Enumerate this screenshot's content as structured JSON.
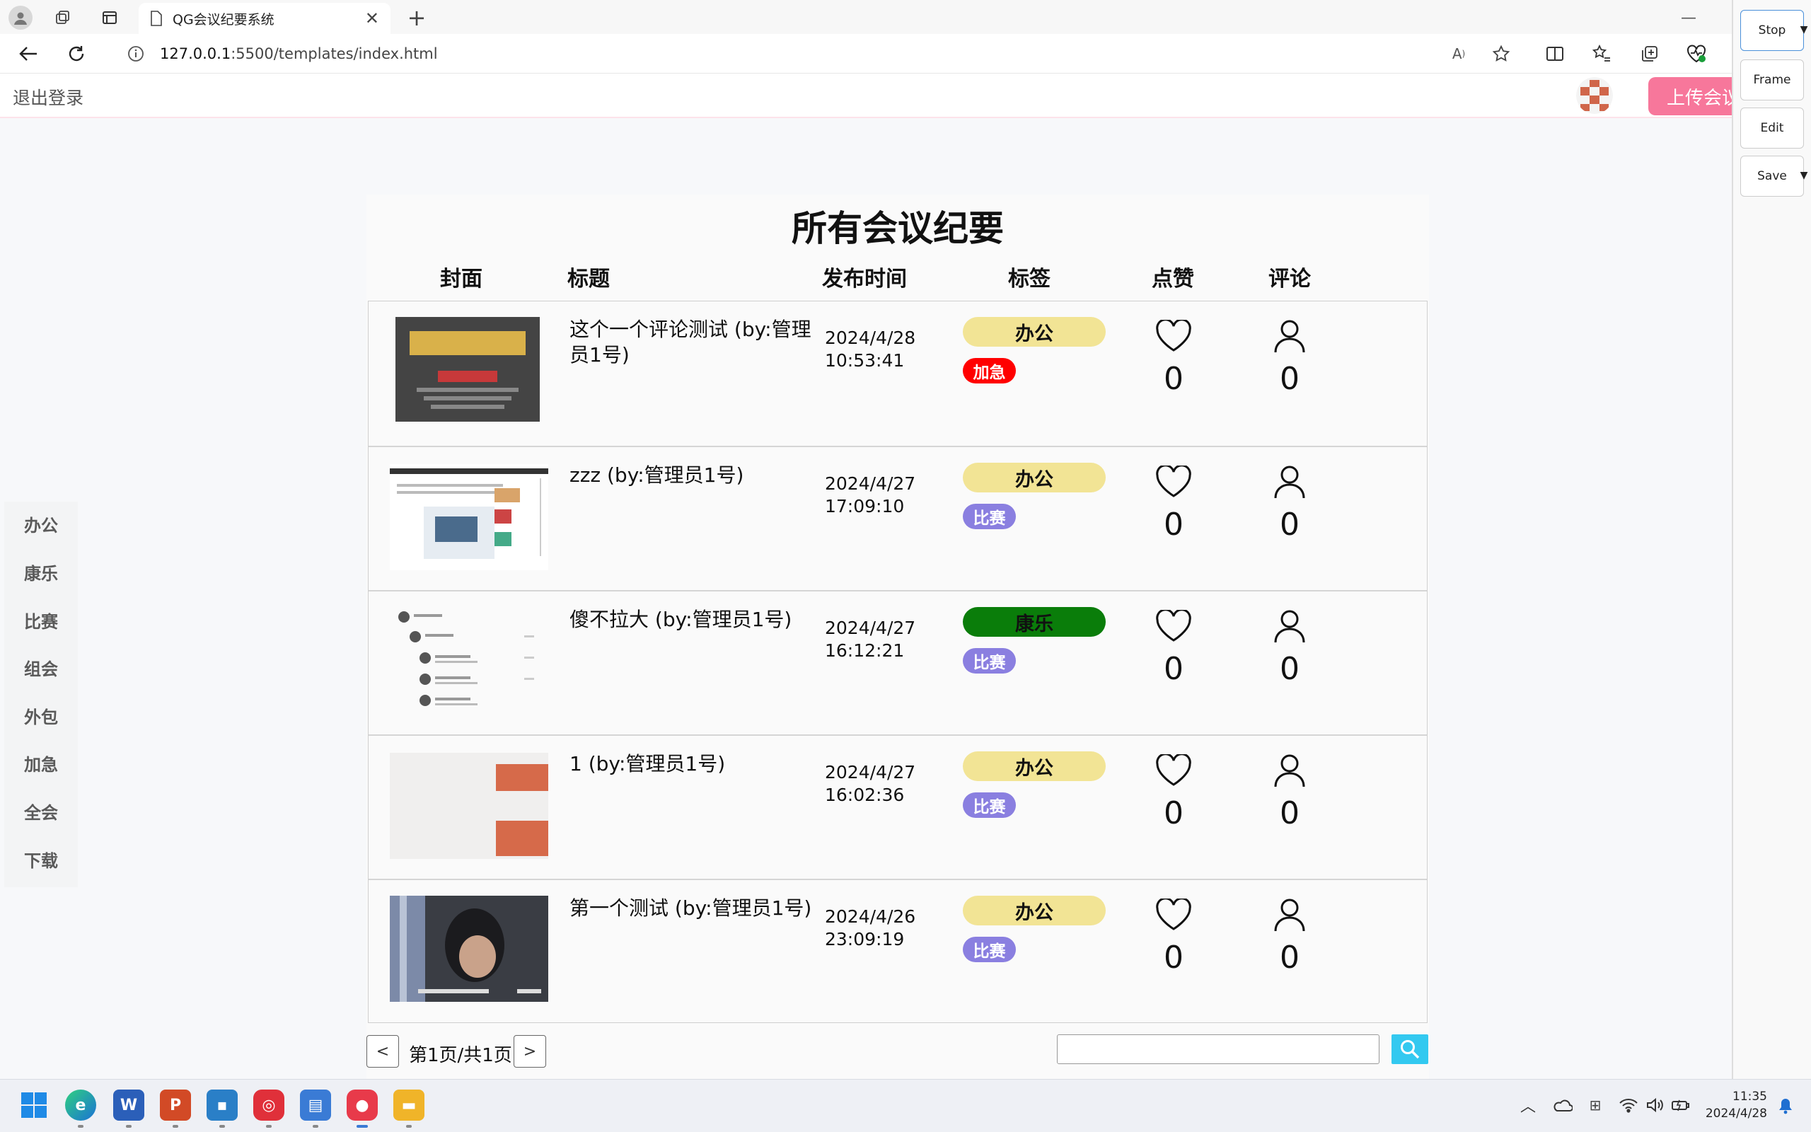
{
  "browser": {
    "tab_title": "QG会议纪要系统",
    "url_host": "127.0.0.1",
    "url_rest": ":5500/templates/index.html"
  },
  "topnav": {
    "logout": "退出登录",
    "upload": "上传会议"
  },
  "sidebar": {
    "items": [
      "办公",
      "康乐",
      "比赛",
      "组会",
      "外包",
      "加急",
      "全会",
      "下载"
    ]
  },
  "main": {
    "title": "所有会议纪要",
    "headers": {
      "cover": "封面",
      "title": "标题",
      "time": "发布时间",
      "tags": "标签",
      "likes": "点赞",
      "comments": "评论"
    },
    "rows": [
      {
        "title": "这个一个评论测试 (by:管理员1号)",
        "date": "2024/4/28",
        "time": "10:53:41",
        "tag1": "办公",
        "tag2": "加急",
        "likes": "0",
        "comments": "0"
      },
      {
        "title": "zzz (by:管理员1号)",
        "date": "2024/4/27",
        "time": "17:09:10",
        "tag1": "办公",
        "tag2": "比赛",
        "likes": "0",
        "comments": "0"
      },
      {
        "title": "傻不拉大 (by:管理员1号)",
        "date": "2024/4/27",
        "time": "16:12:21",
        "tag1": "康乐",
        "tag2": "比赛",
        "likes": "0",
        "comments": "0"
      },
      {
        "title": "1 (by:管理员1号)",
        "date": "2024/4/27",
        "time": "16:02:36",
        "tag1": "办公",
        "tag2": "比赛",
        "likes": "0",
        "comments": "0"
      },
      {
        "title": "第一个测试 (by:管理员1号)",
        "date": "2024/4/26",
        "time": "23:09:19",
        "tag1": "办公",
        "tag2": "比赛",
        "likes": "0",
        "comments": "0"
      }
    ],
    "pager": {
      "info": "第1页/共1页",
      "prev": "<",
      "next": ">"
    },
    "search": {
      "value": "",
      "placeholder": ""
    }
  },
  "colors": {
    "tag_office": "#f2e495",
    "tag_leisure": "#0a7d0a",
    "tag_urgent": "#ff0000",
    "tag_contest": "#8a7fe0",
    "upload": "#f7779b",
    "search_button": "#33c9f0"
  },
  "tool_pane": {
    "stop": "Stop",
    "frame": "Frame",
    "edit": "Edit",
    "save": "Save"
  },
  "taskbar": {
    "time": "11:35",
    "date": "2024/4/28"
  }
}
